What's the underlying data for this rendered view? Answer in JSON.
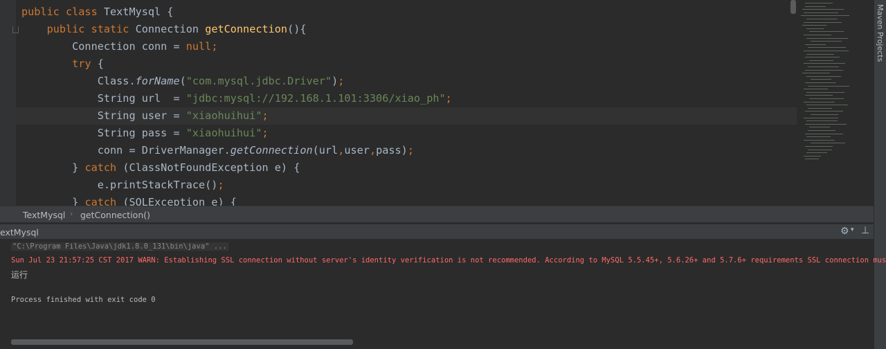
{
  "editor": {
    "lines": [
      [
        {
          "t": "public class ",
          "c": "kw"
        },
        {
          "t": "TextMysql {",
          "c": ""
        }
      ],
      [
        {
          "t": "    ",
          "c": ""
        },
        {
          "t": "public static ",
          "c": "kw"
        },
        {
          "t": "Connection ",
          "c": ""
        },
        {
          "t": "getConnection",
          "c": "fn"
        },
        {
          "t": "(){",
          "c": ""
        }
      ],
      [
        {
          "t": "        Connection conn = ",
          "c": ""
        },
        {
          "t": "null",
          "c": "kw"
        },
        {
          "t": ";",
          "c": "kw"
        }
      ],
      [
        {
          "t": "        ",
          "c": ""
        },
        {
          "t": "try ",
          "c": "kw"
        },
        {
          "t": "{",
          "c": ""
        }
      ],
      [
        {
          "t": "            Class.",
          "c": ""
        },
        {
          "t": "forName",
          "c": "it"
        },
        {
          "t": "(",
          "c": ""
        },
        {
          "t": "\"com.mysql.jdbc.Driver\"",
          "c": "str"
        },
        {
          "t": ")",
          "c": ""
        },
        {
          "t": ";",
          "c": "kw"
        }
      ],
      [
        {
          "t": "            String url  = ",
          "c": ""
        },
        {
          "t": "\"jdbc:mysql://192.168.1.101:3306/xiao_ph\"",
          "c": "str"
        },
        {
          "t": ";",
          "c": "kw"
        }
      ],
      [
        {
          "t": "            String user = ",
          "c": ""
        },
        {
          "t": "\"xiaohuihui\"",
          "c": "str"
        },
        {
          "t": ";",
          "c": "kw"
        }
      ],
      [
        {
          "t": "            String pass = ",
          "c": ""
        },
        {
          "t": "\"xiaohuihui\"",
          "c": "str"
        },
        {
          "t": ";",
          "c": "kw"
        }
      ],
      [
        {
          "t": "            conn = DriverManager.",
          "c": ""
        },
        {
          "t": "getConnection",
          "c": "it"
        },
        {
          "t": "(url",
          "c": ""
        },
        {
          "t": ",",
          "c": "kw"
        },
        {
          "t": "user",
          "c": ""
        },
        {
          "t": ",",
          "c": "kw"
        },
        {
          "t": "pass)",
          "c": ""
        },
        {
          "t": ";",
          "c": "kw"
        }
      ],
      [
        {
          "t": "        } ",
          "c": ""
        },
        {
          "t": "catch ",
          "c": "kw"
        },
        {
          "t": "(ClassNotFoundException e) {",
          "c": ""
        }
      ],
      [
        {
          "t": "            e.printStackTrace()",
          "c": ""
        },
        {
          "t": ";",
          "c": "kw"
        }
      ],
      [
        {
          "t": "        } ",
          "c": ""
        },
        {
          "t": "catch ",
          "c": "kw"
        },
        {
          "t": "(SQLException e) {",
          "c": ""
        }
      ]
    ],
    "current_line": 7
  },
  "side_panel": {
    "maven_label": "Maven Projects"
  },
  "breadcrumb": {
    "class_name": "TextMysql",
    "method_name": "getConnection()"
  },
  "run_panel": {
    "title": "extMysql"
  },
  "console": {
    "command": "\"C:\\Program Files\\Java\\jdk1.8.0_131\\bin\\java\" ...",
    "warning": "Sun Jul 23 21:57:25 CST 2017 WARN: Establishing SSL connection without server's identity verification is not recommended. According to MySQL 5.5.45+, 5.6.26+ and 5.7.6+ requirements SSL connection must be est",
    "output": "运行",
    "finished": "Process finished with exit code 0"
  },
  "icons": {
    "gear": "gear-icon",
    "pin": "pin-icon",
    "fold": "fold-marker-icon"
  },
  "colors": {
    "keyword": "#cc7832",
    "string": "#6a8759",
    "method": "#ffc66d",
    "text": "#a9b7c6",
    "error": "#ff6b68"
  }
}
